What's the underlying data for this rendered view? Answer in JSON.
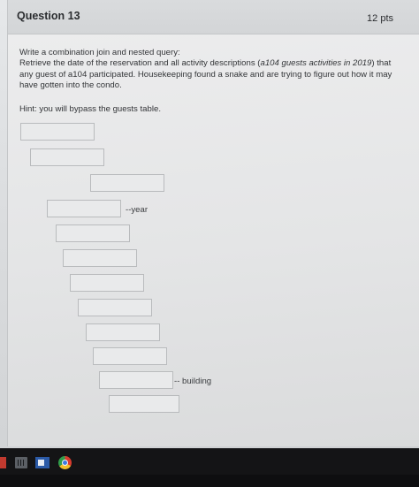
{
  "question": {
    "title": "Question 13",
    "points": "12 pts",
    "line_1": "Write a combination join and nested query:",
    "line_2_before": "Retrieve the date of the reservation and all activity descriptions (",
    "line_2_emphasis": "a104 guests activities in 2019",
    "line_2_after": ") that",
    "line_3": "any guest of a104 participated. Housekeeping found a snake and are trying to figure out how it may",
    "line_4": "have gotten into the condo.",
    "hint": "Hint: you will bypass the guests table."
  },
  "answer_labels": {
    "year": "--year",
    "building": "-- building"
  },
  "answer_blank_count": 14
}
